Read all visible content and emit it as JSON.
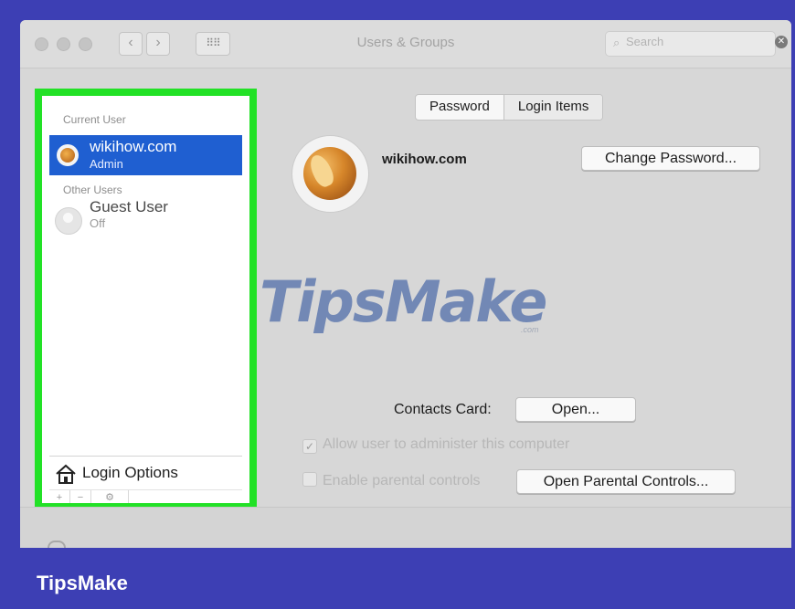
{
  "titlebar": {
    "title": "Users & Groups",
    "back_glyph": "‹",
    "forward_glyph": "›",
    "grid_glyph": "⠿⠿",
    "search_placeholder": "Search",
    "search_icon": "magnifier-icon",
    "clear_icon": "x-circle-icon"
  },
  "sidebar": {
    "current_user_heading": "Current User",
    "current_user": {
      "name": "wikihow.com",
      "role": "Admin"
    },
    "other_users_heading": "Other Users",
    "other_users": [
      {
        "name": "Guest User",
        "status": "Off"
      }
    ],
    "login_options_label": "Login Options",
    "tool_glyphs": [
      "+",
      "−",
      "⚙"
    ]
  },
  "main": {
    "tabs": [
      {
        "label": "Password",
        "active": false
      },
      {
        "label": "Login Items",
        "active": true
      }
    ],
    "profile_name": "wikihow.com",
    "change_password_label": "Change Password...",
    "contacts_card_label": "Contacts Card:",
    "contacts_open_label": "Open...",
    "allow_admin_label": "Allow user to administer this computer",
    "allow_admin_checked": true,
    "parental_controls_label": "Enable parental controls",
    "parental_controls_checked": false,
    "open_parental_label": "Open Parental Controls..."
  },
  "overlay": {
    "watermark": "TipsMake",
    "watermark_suffix": ".com",
    "brand": "TipsMake"
  },
  "colors": {
    "frame": "#3d3fb4",
    "highlight": "#22e126",
    "selection": "#1f5fd1"
  }
}
